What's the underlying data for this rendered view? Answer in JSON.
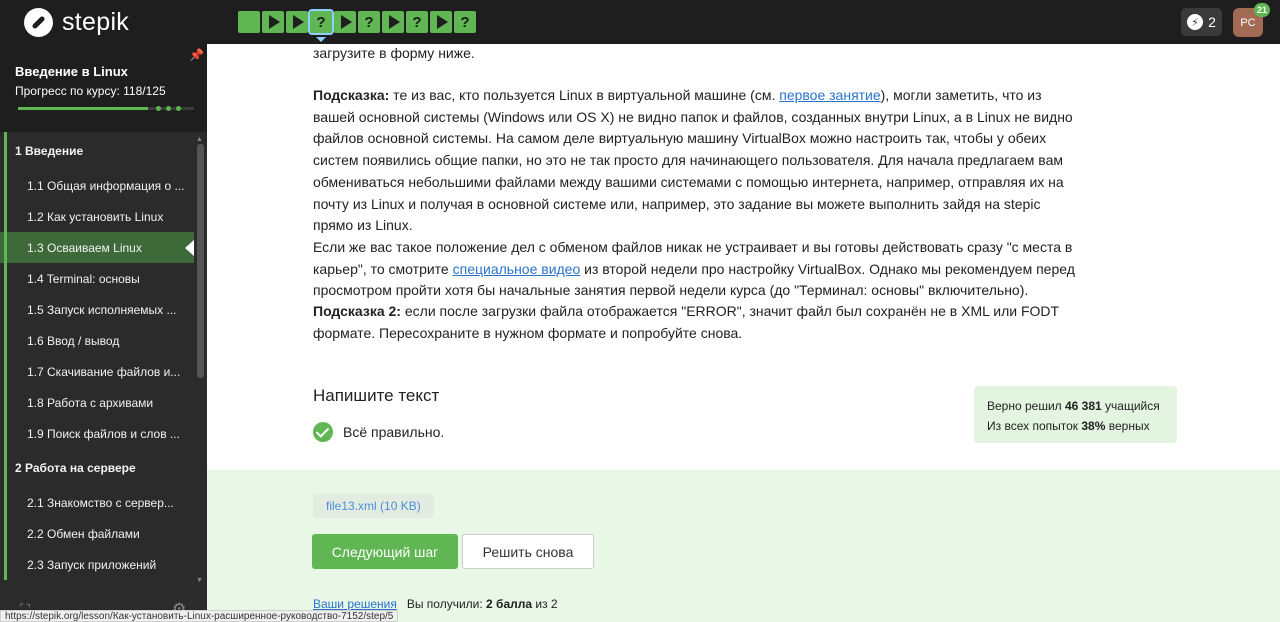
{
  "brand": {
    "name": "stepik"
  },
  "steps": [
    {
      "kind": "square",
      "glyph": ""
    },
    {
      "kind": "play",
      "glyph": ""
    },
    {
      "kind": "play",
      "glyph": ""
    },
    {
      "kind": "quiz",
      "glyph": "?",
      "active": true
    },
    {
      "kind": "play",
      "glyph": ""
    },
    {
      "kind": "quiz",
      "glyph": "?"
    },
    {
      "kind": "play",
      "glyph": ""
    },
    {
      "kind": "quiz",
      "glyph": "?"
    },
    {
      "kind": "play",
      "glyph": ""
    },
    {
      "kind": "quiz",
      "glyph": "?"
    }
  ],
  "header": {
    "energy_count": "2",
    "avatar_initials": "РС",
    "notifications": "21"
  },
  "sidebar": {
    "course_title": "Введение в Linux",
    "progress_label": "Прогресс по курсу:  118/125",
    "progress_fraction": 0.944,
    "items": [
      {
        "label": "1  Введение",
        "section": true
      },
      {
        "label": "1.1  Общая информация о ..."
      },
      {
        "label": "1.2  Как установить Linux"
      },
      {
        "label": "1.3  Осваиваем Linux",
        "active": true
      },
      {
        "label": "1.4  Terminal: основы"
      },
      {
        "label": "1.5  Запуск исполняемых ..."
      },
      {
        "label": "1.6  Ввод / вывод"
      },
      {
        "label": "1.7  Скачивание файлов и..."
      },
      {
        "label": "1.8  Работа с архивами"
      },
      {
        "label": "1.9  Поиск файлов и слов ..."
      },
      {
        "label": "2  Работа на сервере",
        "section": true
      },
      {
        "label": "2.1  Знакомство с сервер..."
      },
      {
        "label": "2.2  Обмен файлами"
      },
      {
        "label": "2.3  Запуск приложений"
      }
    ]
  },
  "content": {
    "intro_line": "загрузите в форму ниже.",
    "hint1_label": "Подсказка:",
    "hint1_a": " те из вас, кто пользуется Linux в виртуальной машине (см. ",
    "hint1_link": "первое занятие",
    "hint1_b": "), могли заметить, что из вашей основной системы (Windows или OS X) не видно папок и файлов, созданных внутри Linux, а в Linux не видно файлов основной системы. На самом деле виртуальную машину VirtualBox можно настроить так, чтобы у обеих систем появились общие папки, но это не так просто для начинающего пользователя. Для начала предлагаем вам обмениваться небольшими файлами между вашими системами с помощью интернета, например, отправляя их на почту из Linux и получая в основной системе или, например, это задание вы можете выполнить зайдя на stepic прямо из Linux.",
    "hint1_c": "Если же вас такое положение дел с обменом файлов никак не устраивает и вы готовы действовать сразу \"с места в карьер\", то смотрите ",
    "hint1_link2": "специальное видео",
    "hint1_d": " из второй недели про настройку VirtualBox. Однако мы рекомендуем перед просмотром пройти хотя бы начальные занятия первой недели курса (до \"Терминал: основы\" включительно).",
    "hint2_label": "Подсказка 2:",
    "hint2_text": " если после загрузки файла отображается \"ERROR\", значит файл был сохранён не в XML или FODT формате. Пересохраните в нужном формате и попробуйте снова.",
    "task_heading": "Напишите текст",
    "correct_text": "Всё правильно.",
    "stats_solved_a": "Верно решил ",
    "stats_solved_n": "46 381",
    "stats_solved_b": " учащийся",
    "stats_attempts_a": "Из всех попыток ",
    "stats_attempts_n": "38%",
    "stats_attempts_b": " верных",
    "file_chip": "file13.xml (10 KB)",
    "next_button": "Следующий шаг",
    "retry_button": "Решить снова",
    "solutions_link": "Ваши решения",
    "score_a": "Вы получили: ",
    "score_b": "2 балла",
    "score_c": " из 2"
  },
  "status_url": "https://stepik.org/lesson/Как-установить-Linux-расширенное-руководство-7152/step/5"
}
